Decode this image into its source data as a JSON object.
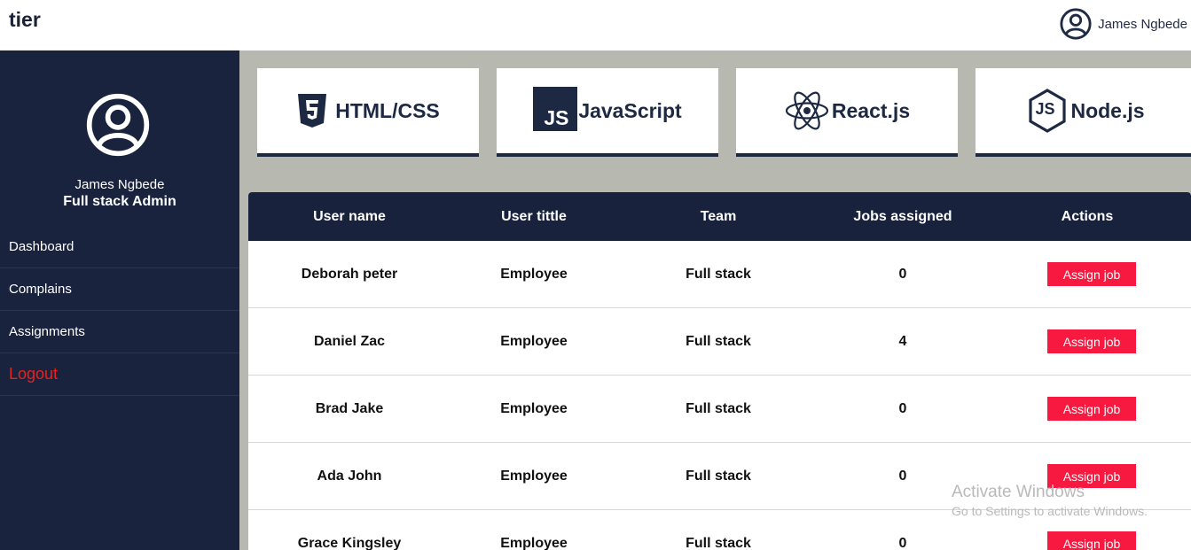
{
  "app": {
    "brand": "tier"
  },
  "header": {
    "user_name": "James Ngbede"
  },
  "sidebar": {
    "profile": {
      "name": "James Ngbede",
      "role": "Full stack Admin"
    },
    "items": [
      {
        "label": "Dashboard"
      },
      {
        "label": "Complains"
      },
      {
        "label": "Assignments"
      },
      {
        "label": "Logout"
      }
    ]
  },
  "cards": [
    {
      "label": "HTML/CSS",
      "icon": "html5-icon"
    },
    {
      "label": "JavaScript",
      "icon": "js-icon",
      "icon_text": "JS"
    },
    {
      "label": "React.js",
      "icon": "react-icon"
    },
    {
      "label": "Node.js",
      "icon": "nodejs-icon",
      "icon_text": "JS"
    }
  ],
  "table": {
    "headers": [
      "User name",
      "User tittle",
      "Team",
      "Jobs assigned",
      "Actions"
    ],
    "rows": [
      {
        "name": "Deborah peter",
        "title": "Employee",
        "team": "Full stack",
        "jobs": "0",
        "action": "Assign job"
      },
      {
        "name": "Daniel Zac",
        "title": "Employee",
        "team": "Full stack",
        "jobs": "4",
        "action": "Assign job"
      },
      {
        "name": "Brad Jake",
        "title": "Employee",
        "team": "Full stack",
        "jobs": "0",
        "action": "Assign job"
      },
      {
        "name": "Ada John",
        "title": "Employee",
        "team": "Full stack",
        "jobs": "0",
        "action": "Assign job"
      },
      {
        "name": "Grace Kingsley",
        "title": "Employee",
        "team": "Full stack",
        "jobs": "0",
        "action": "Assign job"
      }
    ]
  },
  "watermark": {
    "line1": "Activate Windows",
    "line2": "Go to Settings to activate Windows."
  },
  "colors": {
    "navy": "#19233e",
    "accent_red": "#f7193f",
    "logout_red": "#e8211f",
    "content_bg": "#b7b9b0"
  }
}
